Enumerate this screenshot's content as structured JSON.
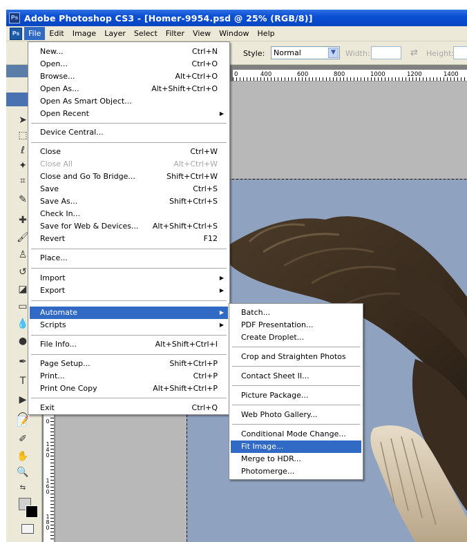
{
  "window": {
    "app_icon": "Ps",
    "title": "Adobe Photoshop CS3 - [Homer-9954.psd @ 25% (RGB/8)]"
  },
  "menubar": {
    "icon": "Ps",
    "items": [
      "File",
      "Edit",
      "Image",
      "Layer",
      "Select",
      "Filter",
      "View",
      "Window",
      "Help"
    ]
  },
  "options": {
    "style_label": "Style:",
    "style_value": "Normal",
    "width_label": "Width:",
    "height_label": "Height:"
  },
  "ruler": {
    "top_ticks": [
      "0",
      "400",
      "600",
      "800",
      "1000",
      "1200",
      "1400"
    ],
    "left_labels": [
      "0",
      "1\n4\n0",
      "1\n6\n0",
      "1\n8\n0"
    ]
  },
  "file_menu": {
    "items": [
      {
        "label": "New...",
        "shortcut": "Ctrl+N"
      },
      {
        "label": "Open...",
        "shortcut": "Ctrl+O"
      },
      {
        "label": "Browse...",
        "shortcut": "Alt+Ctrl+O"
      },
      {
        "label": "Open As...",
        "shortcut": "Alt+Shift+Ctrl+O"
      },
      {
        "label": "Open As Smart Object...",
        "shortcut": ""
      },
      {
        "label": "Open Recent",
        "shortcut": ""
      },
      {
        "label": "Device Central...",
        "shortcut": ""
      },
      {
        "label": "Close",
        "shortcut": "Ctrl+W"
      },
      {
        "label": "Close All",
        "shortcut": "Alt+Ctrl+W"
      },
      {
        "label": "Close and Go To Bridge...",
        "shortcut": "Shift+Ctrl+W"
      },
      {
        "label": "Save",
        "shortcut": "Ctrl+S"
      },
      {
        "label": "Save As...",
        "shortcut": "Shift+Ctrl+S"
      },
      {
        "label": "Check In...",
        "shortcut": ""
      },
      {
        "label": "Save for Web & Devices...",
        "shortcut": "Alt+Shift+Ctrl+S"
      },
      {
        "label": "Revert",
        "shortcut": "F12"
      },
      {
        "label": "Place...",
        "shortcut": ""
      },
      {
        "label": "Import",
        "shortcut": ""
      },
      {
        "label": "Export",
        "shortcut": ""
      },
      {
        "label": "Automate",
        "shortcut": ""
      },
      {
        "label": "Scripts",
        "shortcut": ""
      },
      {
        "label": "File Info...",
        "shortcut": "Alt+Shift+Ctrl+I"
      },
      {
        "label": "Page Setup...",
        "shortcut": "Shift+Ctrl+P"
      },
      {
        "label": "Print...",
        "shortcut": "Ctrl+P"
      },
      {
        "label": "Print One Copy",
        "shortcut": "Alt+Shift+Ctrl+P"
      },
      {
        "label": "Exit",
        "shortcut": "Ctrl+Q"
      }
    ]
  },
  "automate_menu": {
    "items": [
      "Batch...",
      "PDF Presentation...",
      "Create Droplet...",
      "Crop and Straighten Photos",
      "Contact Sheet II...",
      "Picture Package...",
      "Web Photo Gallery...",
      "Conditional Mode Change...",
      "Fit Image...",
      "Merge to HDR...",
      "Photomerge..."
    ]
  },
  "colors": {
    "highlight": "#316ac5",
    "title_bar": "#0a4fd4",
    "sky": "#8fa3c0"
  }
}
